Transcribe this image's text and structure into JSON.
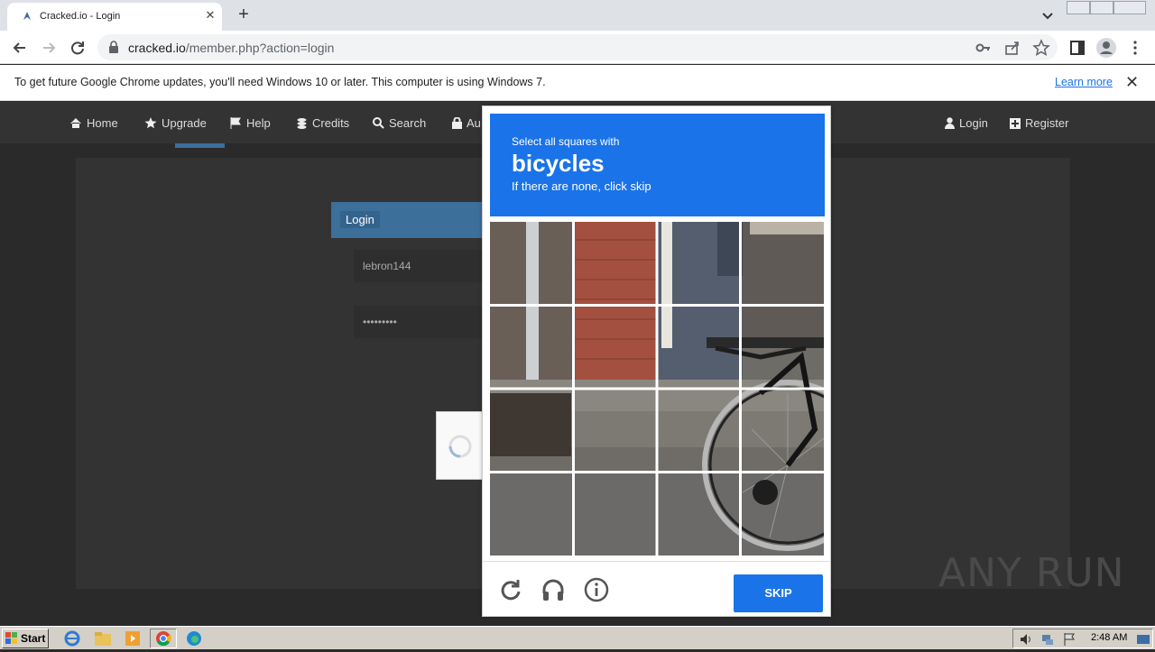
{
  "browser": {
    "tab_title": "Cracked.io - Login",
    "url_host": "cracked.io",
    "url_path": "/member.php?action=login",
    "new_tab": "+"
  },
  "infobar": {
    "message": "To get future Google Chrome updates, you'll need Windows 10 or later. This computer is using Windows 7.",
    "learn_more": "Learn more"
  },
  "site": {
    "nav": {
      "home": "Home",
      "upgrade": "Upgrade",
      "help": "Help",
      "credits": "Credits",
      "search": "Search",
      "auth_partial": "Au",
      "login": "Login",
      "register": "Register"
    },
    "login_panel": {
      "heading": "Login",
      "username_value": "lebron144",
      "password_value": "•••••••••"
    }
  },
  "captcha": {
    "instruction_line1": "Select all squares with",
    "target": "bicycles",
    "instruction_line3": "If there are none, click skip",
    "skip_label": "SKIP",
    "grid_rows": 4,
    "grid_cols": 4
  },
  "watermark": "ANY RUN",
  "taskbar": {
    "start": "Start",
    "clock": "2:48 AM"
  },
  "colors": {
    "captcha_blue": "#1a73e8",
    "site_dark": "#2a2a2a",
    "login_head": "#3c6f9a"
  }
}
